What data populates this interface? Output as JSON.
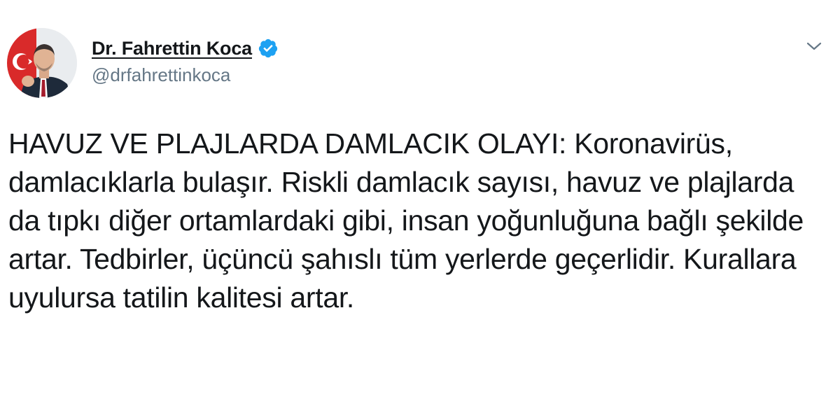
{
  "user": {
    "display_name": "Dr. Fahrettin Koca",
    "handle": "@drfahrettinkoca",
    "verified": true,
    "avatar_icon": "profile-photo"
  },
  "tweet": {
    "text": "HAVUZ VE PLAJLARDA DAMLACIK OLAYI: Koronavirüs, damlacıklarla bulaşır. Riskli damlacık sayısı, havuz ve plajlarda da tıpkı diğer ortamlardaki gibi, insan yoğunluğuna bağlı şekilde artar. Tedbirler, üçüncü şahıslı tüm yerlerde geçerlidir. Kurallara uyulursa tatilin kalitesi artar."
  },
  "icons": {
    "verified_badge": "verified-badge-icon",
    "more_menu": "chevron-down-icon"
  },
  "colors": {
    "verified_blue": "#1da1f2",
    "handle_gray": "#657786",
    "text": "#14171a",
    "avatar_red": "#d92a2a"
  }
}
